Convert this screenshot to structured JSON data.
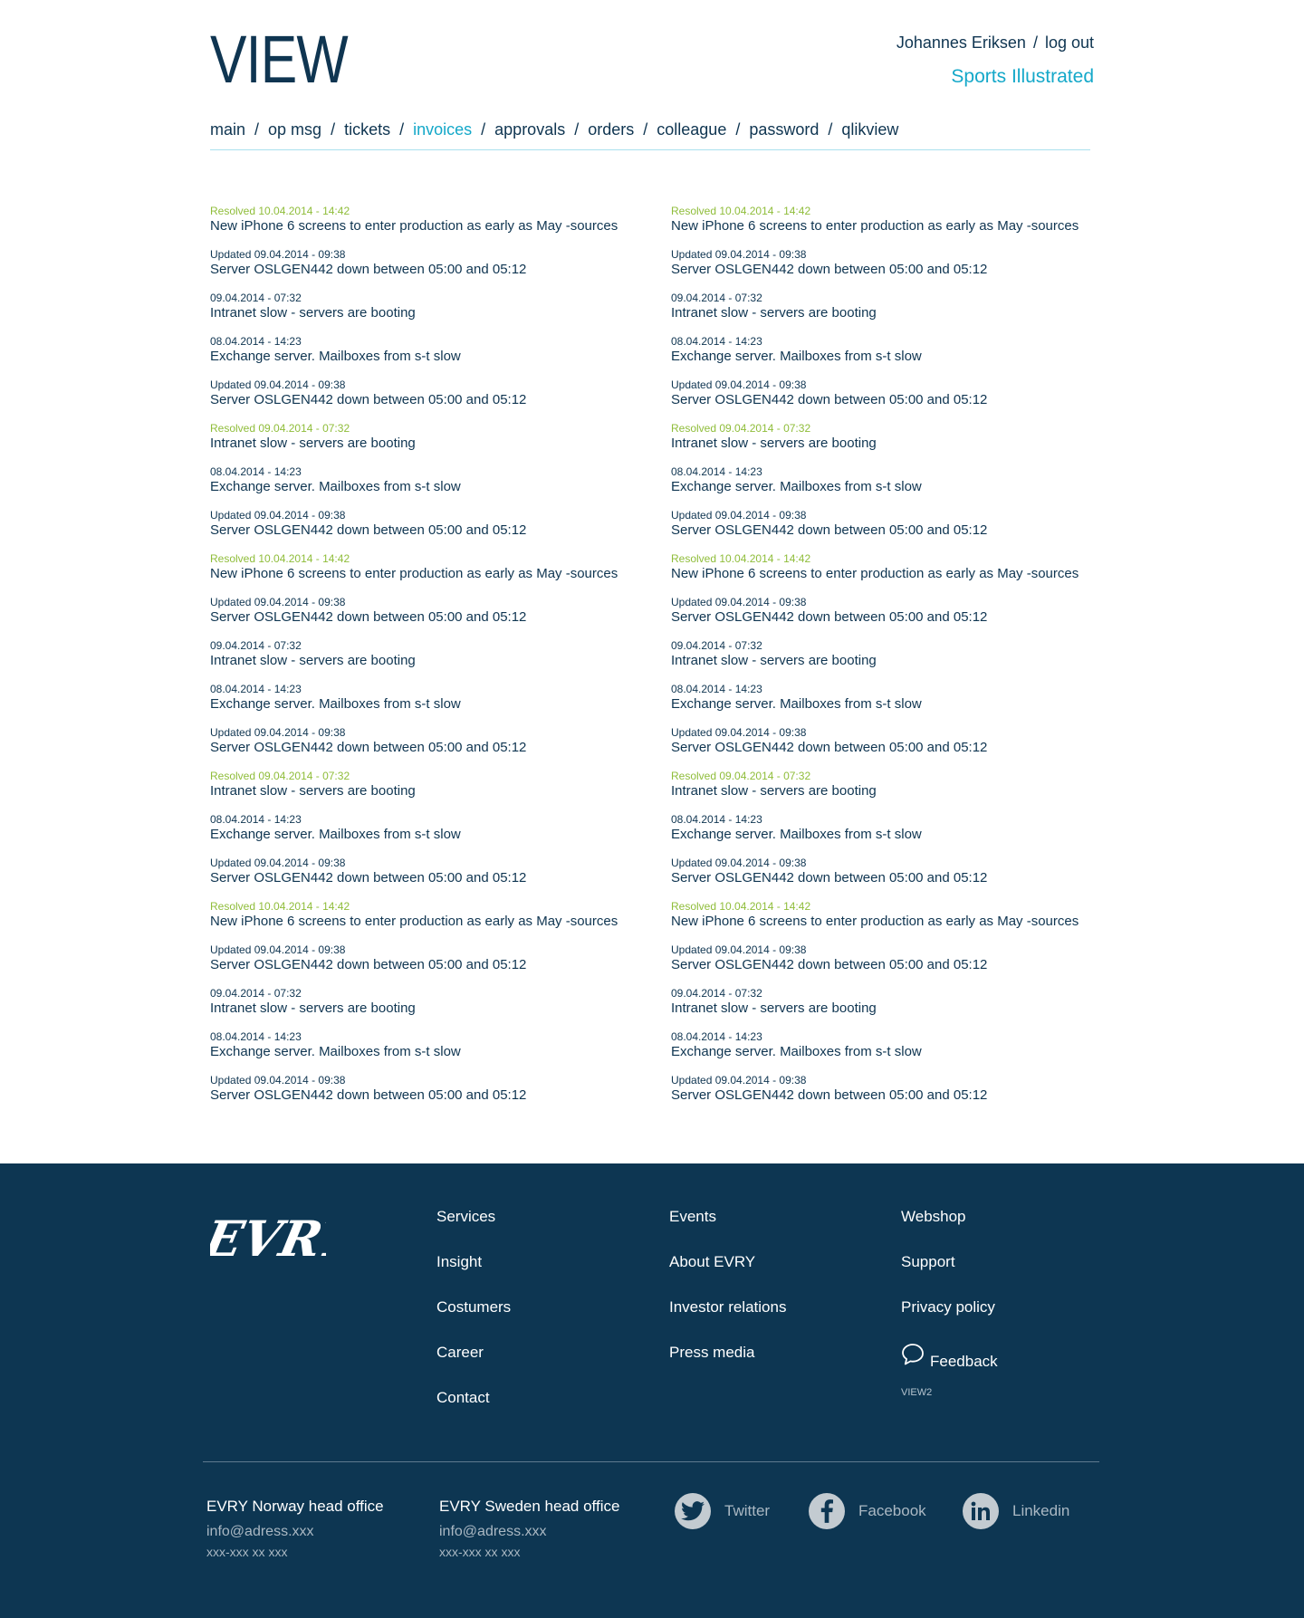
{
  "header": {
    "logo": "VIEW",
    "user_name": "Johannes Eriksen",
    "separator": "/",
    "logout": "log out",
    "client": "Sports Illustrated"
  },
  "nav": {
    "items": [
      "main",
      "op msg",
      "tickets",
      "invoices",
      "approvals",
      "orders",
      "colleague",
      "password",
      "qlikview"
    ],
    "active": "invoices",
    "separator": "/"
  },
  "messages": {
    "left": [
      {
        "meta": "Resolved 10.04.2014 - 14:42",
        "title": "New iPhone 6 screens to enter production as early as May -sources",
        "status": "resolved"
      },
      {
        "meta": "Updated 09.04.2014 - 09:38",
        "title": "Server OSLGEN442 down between 05:00 and 05:12",
        "status": "updated"
      },
      {
        "meta": "09.04.2014 - 07:32",
        "title": "Intranet slow - servers are booting",
        "status": "open"
      },
      {
        "meta": "08.04.2014 - 14:23",
        "title": "Exchange server. Mailboxes from s-t slow",
        "status": "open"
      },
      {
        "meta": "Updated 09.04.2014 - 09:38",
        "title": "Server OSLGEN442 down between 05:00 and 05:12",
        "status": "updated"
      },
      {
        "meta": "Resolved 09.04.2014 - 07:32",
        "title": "Intranet slow - servers are booting",
        "status": "resolved"
      },
      {
        "meta": "08.04.2014 - 14:23",
        "title": "Exchange server. Mailboxes from s-t slow",
        "status": "open"
      },
      {
        "meta": "Updated 09.04.2014 - 09:38",
        "title": "Server OSLGEN442 down between 05:00 and 05:12",
        "status": "updated"
      },
      {
        "meta": "Resolved 10.04.2014 - 14:42",
        "title": "New iPhone 6 screens to enter production as early as May -sources",
        "status": "resolved"
      },
      {
        "meta": "Updated 09.04.2014 - 09:38",
        "title": "Server OSLGEN442 down between 05:00 and 05:12",
        "status": "updated"
      },
      {
        "meta": "09.04.2014 - 07:32",
        "title": "Intranet slow - servers are booting",
        "status": "open"
      },
      {
        "meta": "08.04.2014 - 14:23",
        "title": "Exchange server. Mailboxes from s-t slow",
        "status": "open"
      },
      {
        "meta": "Updated 09.04.2014 - 09:38",
        "title": "Server OSLGEN442 down between 05:00 and 05:12",
        "status": "updated"
      },
      {
        "meta": "Resolved 09.04.2014 - 07:32",
        "title": "Intranet slow - servers are booting",
        "status": "resolved"
      },
      {
        "meta": "08.04.2014 - 14:23",
        "title": "Exchange server. Mailboxes from s-t slow",
        "status": "open"
      },
      {
        "meta": "Updated 09.04.2014 - 09:38",
        "title": "Server OSLGEN442 down between 05:00 and 05:12",
        "status": "updated"
      },
      {
        "meta": "Resolved 10.04.2014 - 14:42",
        "title": "New iPhone 6 screens to enter production as early as May -sources",
        "status": "resolved"
      },
      {
        "meta": "Updated 09.04.2014 - 09:38",
        "title": "Server OSLGEN442 down between 05:00 and 05:12",
        "status": "updated"
      },
      {
        "meta": "09.04.2014 - 07:32",
        "title": "Intranet slow - servers are booting",
        "status": "open"
      },
      {
        "meta": "08.04.2014 - 14:23",
        "title": "Exchange server. Mailboxes from s-t slow",
        "status": "open"
      },
      {
        "meta": "Updated 09.04.2014 - 09:38",
        "title": "Server OSLGEN442 down between 05:00 and 05:12",
        "status": "updated"
      }
    ],
    "right": [
      {
        "meta": "Resolved 10.04.2014 - 14:42",
        "title": "New iPhone 6 screens to enter production as early as May -sources",
        "status": "resolved"
      },
      {
        "meta": "Updated 09.04.2014 - 09:38",
        "title": "Server OSLGEN442 down between 05:00 and 05:12",
        "status": "updated"
      },
      {
        "meta": "09.04.2014 - 07:32",
        "title": "Intranet slow - servers are booting",
        "status": "open"
      },
      {
        "meta": "08.04.2014 - 14:23",
        "title": "Exchange server. Mailboxes from s-t slow",
        "status": "open"
      },
      {
        "meta": "Updated 09.04.2014 - 09:38",
        "title": "Server OSLGEN442 down between 05:00 and 05:12",
        "status": "updated"
      },
      {
        "meta": "Resolved 09.04.2014 - 07:32",
        "title": "Intranet slow - servers are booting",
        "status": "resolved"
      },
      {
        "meta": "08.04.2014 - 14:23",
        "title": "Exchange server. Mailboxes from s-t slow",
        "status": "open"
      },
      {
        "meta": "Updated 09.04.2014 - 09:38",
        "title": "Server OSLGEN442 down between 05:00 and 05:12",
        "status": "updated"
      },
      {
        "meta": "Resolved 10.04.2014 - 14:42",
        "title": "New iPhone 6 screens to enter production as early as May -sources",
        "status": "resolved"
      },
      {
        "meta": "Updated 09.04.2014 - 09:38",
        "title": "Server OSLGEN442 down between 05:00 and 05:12",
        "status": "updated"
      },
      {
        "meta": "09.04.2014 - 07:32",
        "title": "Intranet slow - servers are booting",
        "status": "open"
      },
      {
        "meta": "08.04.2014 - 14:23",
        "title": "Exchange server. Mailboxes from s-t slow",
        "status": "open"
      },
      {
        "meta": "Updated 09.04.2014 - 09:38",
        "title": "Server OSLGEN442 down between 05:00 and 05:12",
        "status": "updated"
      },
      {
        "meta": "Resolved 09.04.2014 - 07:32",
        "title": "Intranet slow - servers are booting",
        "status": "resolved"
      },
      {
        "meta": "08.04.2014 - 14:23",
        "title": "Exchange server. Mailboxes from s-t slow",
        "status": "open"
      },
      {
        "meta": "Updated 09.04.2014 - 09:38",
        "title": "Server OSLGEN442 down between 05:00 and 05:12",
        "status": "updated"
      },
      {
        "meta": "Resolved 10.04.2014 - 14:42",
        "title": "New iPhone 6 screens to enter production as early as May -sources",
        "status": "resolved"
      },
      {
        "meta": "Updated 09.04.2014 - 09:38",
        "title": "Server OSLGEN442 down between 05:00 and 05:12",
        "status": "updated"
      },
      {
        "meta": "09.04.2014 - 07:32",
        "title": "Intranet slow - servers are booting",
        "status": "open"
      },
      {
        "meta": "08.04.2014 - 14:23",
        "title": "Exchange server. Mailboxes from s-t slow",
        "status": "open"
      },
      {
        "meta": "Updated 09.04.2014 - 09:38",
        "title": "Server OSLGEN442 down between 05:00 and 05:12",
        "status": "updated"
      }
    ]
  },
  "footer": {
    "logo": "EVRY",
    "links_col1": [
      "Services",
      "Insight",
      "Costumers",
      "Career",
      "Contact"
    ],
    "links_col2": [
      "Events",
      "About EVRY",
      "Investor relations",
      "Press media"
    ],
    "links_col3": [
      "Webshop",
      "Support",
      "Privacy policy"
    ],
    "feedback": "Feedback",
    "version": "VIEW2",
    "offices": [
      {
        "name": "EVRY Norway head office",
        "email": "info@adress.xxx",
        "phone": "xxx-xxx xx xxx"
      },
      {
        "name": "EVRY Sweden head office",
        "email": "info@adress.xxx",
        "phone": "xxx-xxx xx xxx"
      }
    ],
    "social": [
      {
        "label": "Twitter",
        "icon": "twitter-icon"
      },
      {
        "label": "Facebook",
        "icon": "facebook-icon"
      },
      {
        "label": "Linkedin",
        "icon": "linkedin-icon"
      }
    ]
  },
  "colors": {
    "navy": "#0f3551",
    "accent": "#14a8c9",
    "resolved": "#8fbd3a",
    "footer_bg": "#0d3652"
  }
}
